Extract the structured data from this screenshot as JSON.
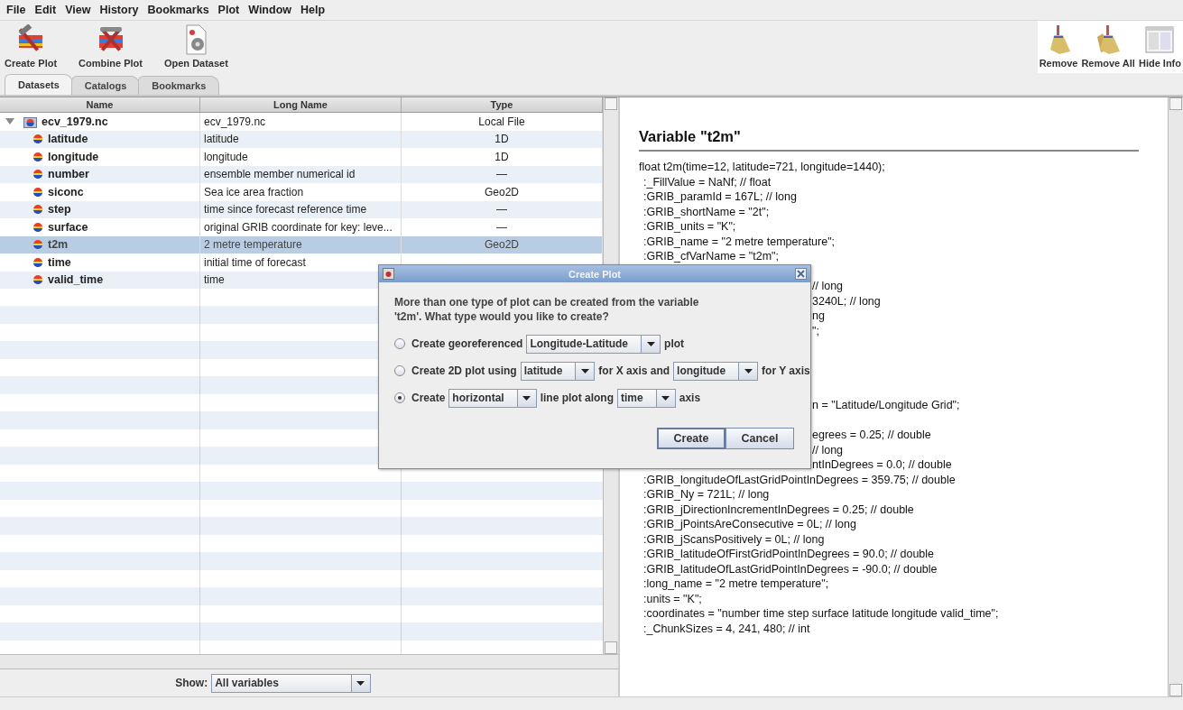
{
  "menu": [
    "File",
    "Edit",
    "View",
    "History",
    "Bookmarks",
    "Plot",
    "Window",
    "Help"
  ],
  "toolbar_left": [
    {
      "label": "Create Plot",
      "kind": "create"
    },
    {
      "label": "Combine Plot",
      "kind": "combine"
    },
    {
      "label": "Open Dataset",
      "kind": "open"
    }
  ],
  "toolbar_right": [
    {
      "label": "Remove",
      "kind": "remove"
    },
    {
      "label": "Remove All",
      "kind": "remove_all"
    },
    {
      "label": "Hide Info",
      "kind": "info"
    }
  ],
  "tabs": [
    {
      "label": "Datasets",
      "selected": true
    },
    {
      "label": "Catalogs",
      "selected": false
    },
    {
      "label": "Bookmarks",
      "selected": false
    }
  ],
  "table": {
    "columns": [
      "Name",
      "Long Name",
      "Type"
    ],
    "rows": [
      {
        "name": "ecv_1979.nc",
        "long_name": "ecv_1979.nc",
        "type": "Local File",
        "kind": "file",
        "expanded": true,
        "selected": false,
        "children": [
          {
            "name": "latitude",
            "long_name": "latitude",
            "type": "1D",
            "kind": "variable",
            "selected": false
          },
          {
            "name": "longitude",
            "long_name": "longitude",
            "type": "1D",
            "kind": "variable",
            "selected": false
          },
          {
            "name": "number",
            "long_name": "ensemble member numerical id",
            "type": "—",
            "kind": "variable",
            "selected": false
          },
          {
            "name": "siconc",
            "long_name": "Sea ice area fraction",
            "type": "Geo2D",
            "kind": "variable",
            "selected": false
          },
          {
            "name": "step",
            "long_name": "time since forecast reference time",
            "type": "—",
            "kind": "variable",
            "selected": false
          },
          {
            "name": "surface",
            "long_name": "original GRIB coordinate for key: leve...",
            "type": "—",
            "kind": "variable",
            "selected": false
          },
          {
            "name": "t2m",
            "long_name": "2 metre temperature",
            "type": "Geo2D",
            "kind": "variable",
            "selected": true
          },
          {
            "name": "time",
            "long_name": "initial time of forecast",
            "kind": "variable",
            "selected": false
          },
          {
            "name": "valid_time",
            "long_name": "time",
            "kind": "variable",
            "selected": false
          }
        ]
      }
    ]
  },
  "show_filter": {
    "label": "Show:",
    "value": "All variables"
  },
  "info": {
    "title": "Variable \"t2m\"",
    "lines": [
      {
        "kind": "full",
        "text": "float t2m(time=12, latitude=721, longitude=1440);"
      },
      {
        "kind": "full",
        "text": ":_FillValue = NaNf; // float"
      },
      {
        "kind": "full",
        "text": ":GRIB_paramId = 167L; // long"
      },
      {
        "kind": "full",
        "text": ":GRIB_shortName = \"2t\";"
      },
      {
        "kind": "full",
        "text": ":GRIB_units = \"K\";"
      },
      {
        "kind": "full",
        "text": ":GRIB_name = \"2 metre temperature\";"
      },
      {
        "kind": "full",
        "text": ":GRIB_cfVarName = \"t2m\";"
      },
      {
        "kind": "covered"
      },
      {
        "kind": "partial",
        "text": "// long"
      },
      {
        "kind": "partial",
        "text": "3240L; // long"
      },
      {
        "kind": "partial",
        "text": "ng"
      },
      {
        "kind": "partial",
        "text": "\";"
      },
      {
        "kind": "covered"
      },
      {
        "kind": "covered"
      },
      {
        "kind": "covered"
      },
      {
        "kind": "covered"
      },
      {
        "kind": "partial",
        "text": "n = \"Latitude/Longitude Grid\";"
      },
      {
        "kind": "covered"
      },
      {
        "kind": "partial",
        "text": "egrees = 0.25; // double"
      },
      {
        "kind": "partial",
        "text": "// long"
      },
      {
        "kind": "partial",
        "text": "ntInDegrees = 0.0; // double"
      },
      {
        "kind": "full",
        "text": ":GRIB_longitudeOfLastGridPointInDegrees = 359.75; // double"
      },
      {
        "kind": "full",
        "text": ":GRIB_Ny = 721L; // long"
      },
      {
        "kind": "full",
        "text": ":GRIB_jDirectionIncrementInDegrees = 0.25; // double"
      },
      {
        "kind": "full",
        "text": ":GRIB_jPointsAreConsecutive = 0L; // long"
      },
      {
        "kind": "full",
        "text": ":GRIB_jScansPositively = 0L; // long"
      },
      {
        "kind": "full",
        "text": ":GRIB_latitudeOfFirstGridPointInDegrees = 90.0; // double"
      },
      {
        "kind": "full",
        "text": ":GRIB_latitudeOfLastGridPointInDegrees = -90.0; // double"
      },
      {
        "kind": "full",
        "text": ":long_name = \"2 metre temperature\";"
      },
      {
        "kind": "full",
        "text": ":units = \"K\";"
      },
      {
        "kind": "full",
        "text": ":coordinates = \"number time step surface latitude longitude valid_time\";"
      },
      {
        "kind": "full",
        "text": ":_ChunkSizes = 4, 241, 480; // int"
      }
    ]
  },
  "dialog": {
    "title": "Create Plot",
    "message": "More than one type of plot can be created from the variable 't2m'. What type would you like to create?",
    "options": [
      {
        "selected": false,
        "parts": [
          {
            "kind": "text",
            "text": "Create georeferenced"
          },
          {
            "kind": "dropdown",
            "value": "Longitude-Latitude"
          },
          {
            "kind": "text",
            "text": "plot"
          }
        ]
      },
      {
        "selected": false,
        "parts": [
          {
            "kind": "text",
            "text": "Create 2D plot using"
          },
          {
            "kind": "dropdown",
            "value": "latitude"
          },
          {
            "kind": "text",
            "text": "for X axis and"
          },
          {
            "kind": "dropdown",
            "value": "longitude"
          },
          {
            "kind": "text",
            "text": "for Y axis"
          }
        ]
      },
      {
        "selected": true,
        "parts": [
          {
            "kind": "text",
            "text": "Create"
          },
          {
            "kind": "dropdown",
            "value": "horizontal"
          },
          {
            "kind": "text",
            "text": "line plot along"
          },
          {
            "kind": "dropdown",
            "value": "time"
          },
          {
            "kind": "text",
            "text": "axis"
          }
        ]
      }
    ],
    "buttons": [
      {
        "label": "Create",
        "kind": "default"
      },
      {
        "label": "Cancel",
        "kind": "normal"
      }
    ]
  }
}
